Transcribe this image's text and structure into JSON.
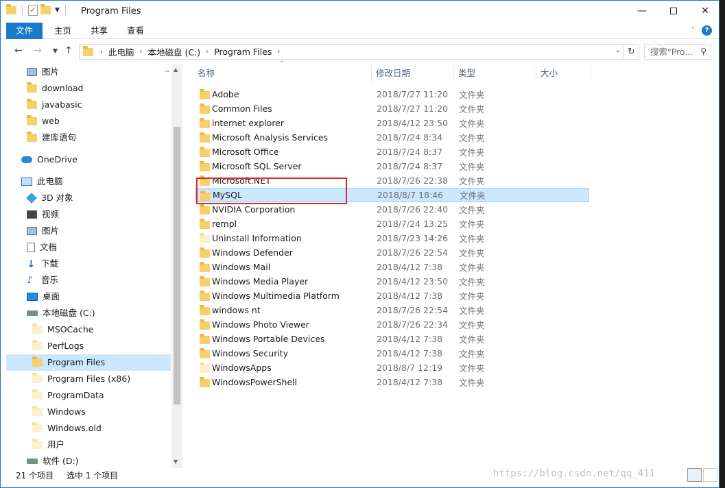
{
  "window": {
    "title": "Program Files",
    "minimize": "—",
    "maximize": "",
    "close": "✕"
  },
  "ribbon": {
    "tabs": [
      "文件",
      "主页",
      "共享",
      "查看"
    ],
    "help": "?"
  },
  "address": {
    "crumbs": [
      "此电脑",
      "本地磁盘 (C:)",
      "Program Files"
    ],
    "search_placeholder": "搜索\"Pro..."
  },
  "nav_pane": [
    {
      "label": "图片",
      "icon": "picture-icon",
      "pinned": true
    },
    {
      "label": "download",
      "icon": "folder-icon"
    },
    {
      "label": "javabasic",
      "icon": "folder-icon"
    },
    {
      "label": "web",
      "icon": "folder-icon"
    },
    {
      "label": "建库语句",
      "icon": "folder-icon"
    },
    {
      "label": "OneDrive",
      "icon": "onedrive-icon"
    },
    {
      "label": "此电脑",
      "icon": "this-pc-icon"
    },
    {
      "label": "3D 对象",
      "icon": "3d-objects-icon"
    },
    {
      "label": "视频",
      "icon": "video-icon"
    },
    {
      "label": "图片",
      "icon": "picture-icon"
    },
    {
      "label": "文档",
      "icon": "document-icon"
    },
    {
      "label": "下载",
      "icon": "download-icon"
    },
    {
      "label": "音乐",
      "icon": "music-icon"
    },
    {
      "label": "桌面",
      "icon": "desktop-icon"
    },
    {
      "label": "本地磁盘 (C:)",
      "icon": "drive-icon"
    },
    {
      "label": "MSOCache",
      "icon": "folder-icon"
    },
    {
      "label": "PerfLogs",
      "icon": "folder-icon"
    },
    {
      "label": "Program Files",
      "icon": "folder-icon",
      "selected": true
    },
    {
      "label": "Program Files (x86)",
      "icon": "folder-icon"
    },
    {
      "label": "ProgramData",
      "icon": "folder-icon"
    },
    {
      "label": "Windows",
      "icon": "folder-icon"
    },
    {
      "label": "Windows.old",
      "icon": "folder-icon"
    },
    {
      "label": "用户",
      "icon": "folder-icon"
    },
    {
      "label": "软件 (D:)",
      "icon": "drive-icon"
    }
  ],
  "columns": {
    "name": "名称",
    "modified": "修改日期",
    "type": "类型",
    "size": "大小"
  },
  "files": [
    {
      "name": "Adobe",
      "modified": "2018/7/27 11:20",
      "type": "文件夹"
    },
    {
      "name": "Common Files",
      "modified": "2018/7/27 11:20",
      "type": "文件夹"
    },
    {
      "name": "internet explorer",
      "modified": "2018/4/12 23:50",
      "type": "文件夹"
    },
    {
      "name": "Microsoft Analysis Services",
      "modified": "2018/7/24 8:34",
      "type": "文件夹"
    },
    {
      "name": "Microsoft Office",
      "modified": "2018/7/24 8:37",
      "type": "文件夹"
    },
    {
      "name": "Microsoft SQL Server",
      "modified": "2018/7/24 8:37",
      "type": "文件夹"
    },
    {
      "name": "Microsoft.NET",
      "modified": "2018/7/26 22:38",
      "type": "文件夹"
    },
    {
      "name": "MySQL",
      "modified": "2018/8/7 18:46",
      "type": "文件夹",
      "selected": true
    },
    {
      "name": "NVIDIA Corporation",
      "modified": "2018/7/26 22:40",
      "type": "文件夹"
    },
    {
      "name": "rempl",
      "modified": "2018/7/24 13:25",
      "type": "文件夹"
    },
    {
      "name": "Uninstall Information",
      "modified": "2018/7/23 14:26",
      "type": "文件夹"
    },
    {
      "name": "Windows Defender",
      "modified": "2018/7/26 22:54",
      "type": "文件夹"
    },
    {
      "name": "Windows Mail",
      "modified": "2018/4/12 7:38",
      "type": "文件夹"
    },
    {
      "name": "Windows Media Player",
      "modified": "2018/4/12 23:50",
      "type": "文件夹"
    },
    {
      "name": "Windows Multimedia Platform",
      "modified": "2018/4/12 7:38",
      "type": "文件夹"
    },
    {
      "name": "windows nt",
      "modified": "2018/7/26 22:54",
      "type": "文件夹"
    },
    {
      "name": "Windows Photo Viewer",
      "modified": "2018/7/26 22:34",
      "type": "文件夹"
    },
    {
      "name": "Windows Portable Devices",
      "modified": "2018/4/12 7:38",
      "type": "文件夹"
    },
    {
      "name": "Windows Security",
      "modified": "2018/4/12 7:38",
      "type": "文件夹"
    },
    {
      "name": "WindowsApps",
      "modified": "2018/8/7 12:19",
      "type": "文件夹"
    },
    {
      "name": "WindowsPowerShell",
      "modified": "2018/4/12 7:38",
      "type": "文件夹"
    }
  ],
  "status": {
    "count": "21 个项目",
    "selection": "选中 1 个项目"
  },
  "watermark": "https://blog.csdn.net/qq_411",
  "colors": {
    "accent": "#1979ca",
    "selection": "#cce8ff",
    "annotation": "#e0262b"
  }
}
